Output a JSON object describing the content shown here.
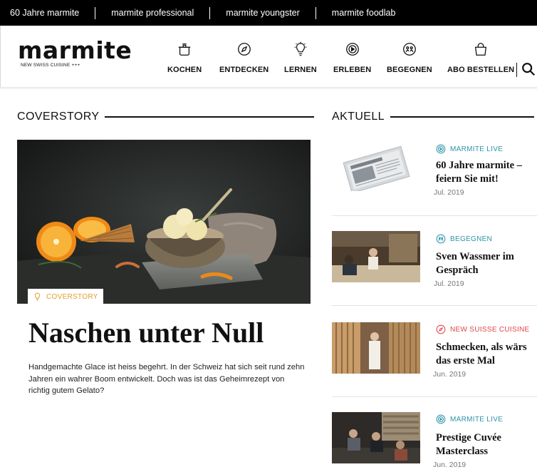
{
  "topbar": {
    "links": [
      "60 Jahre marmite",
      "marmite professional",
      "marmite youngster",
      "marmite foodlab"
    ]
  },
  "header": {
    "logo": "marmite",
    "tagline": "NEW SWISS CUISINE +++",
    "nav": [
      {
        "label": "KOCHEN",
        "icon": "pot-icon"
      },
      {
        "label": "ENTDECKEN",
        "icon": "compass-icon"
      },
      {
        "label": "LERNEN",
        "icon": "lightbulb-icon"
      },
      {
        "label": "ERLEBEN",
        "icon": "play-circle-icon"
      },
      {
        "label": "BEGEGNEN",
        "icon": "people-circle-icon"
      },
      {
        "label": "ABO BESTELLEN",
        "icon": "shopping-bag-icon"
      }
    ],
    "search_icon": "search-icon"
  },
  "cover": {
    "section_title": "COVERSTORY",
    "badge": "COVERSTORY",
    "badge_icon": "lightbulb-icon",
    "badge_color": "#e0a02a",
    "headline": "Naschen unter Null",
    "teaser": "Handgemachte Glace ist heiss begehrt. In der Schweiz hat sich seit rund zehn Jahren ein wahrer Boom entwickelt. Doch was ist das Geheimrezept von richtig gutem Gelato?"
  },
  "aktuell": {
    "section_title": "AKTUELL",
    "items": [
      {
        "category": "MARMITE LIVE",
        "category_color": "#2e94a8",
        "icon": "play-circle-icon",
        "title": "60 Jahre marmite – feiern Sie mit!",
        "date": "Jul. 2019"
      },
      {
        "category": "BEGEGNEN",
        "category_color": "#2e94a8",
        "icon": "people-circle-icon",
        "title": "Sven Wassmer im Gespräch",
        "date": "Jul. 2019"
      },
      {
        "category": "NEW SUISSE CUISINE",
        "category_color": "#e0454a",
        "icon": "compass-icon",
        "title": "Schmecken, als wärs das erste Mal",
        "date": "Jun. 2019"
      },
      {
        "category": "MARMITE LIVE",
        "category_color": "#2e94a8",
        "icon": "play-circle-icon",
        "title": "Prestige Cuvée Masterclass",
        "date": "Jun. 2019"
      }
    ]
  }
}
